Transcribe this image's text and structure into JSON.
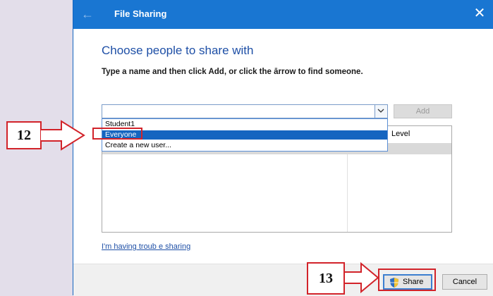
{
  "window": {
    "title": "File Sharing",
    "back_icon": "back-arrow-icon",
    "close_icon": "close-icon"
  },
  "main": {
    "heading": "Choose people to share with",
    "instruction": "Type a name and then click Add, or click the ārrow to find someone.",
    "combo_value": "",
    "add_label": "Add",
    "list_column_level": "Level",
    "dropdown_items": [
      "Student1",
      "Everyone",
      "Create a new user..."
    ],
    "dropdown_selected": "Everyone",
    "trouble_link": "I'm having troub e sharing"
  },
  "footer": {
    "share_label": "Share",
    "cancel_label": "Cancel"
  },
  "callouts": {
    "step12": "12",
    "step13": "13"
  },
  "colors": {
    "titlebar": "#1976d2",
    "accent": "#1565c0",
    "callout_red": "#d2232a",
    "background": "#e3deea"
  }
}
